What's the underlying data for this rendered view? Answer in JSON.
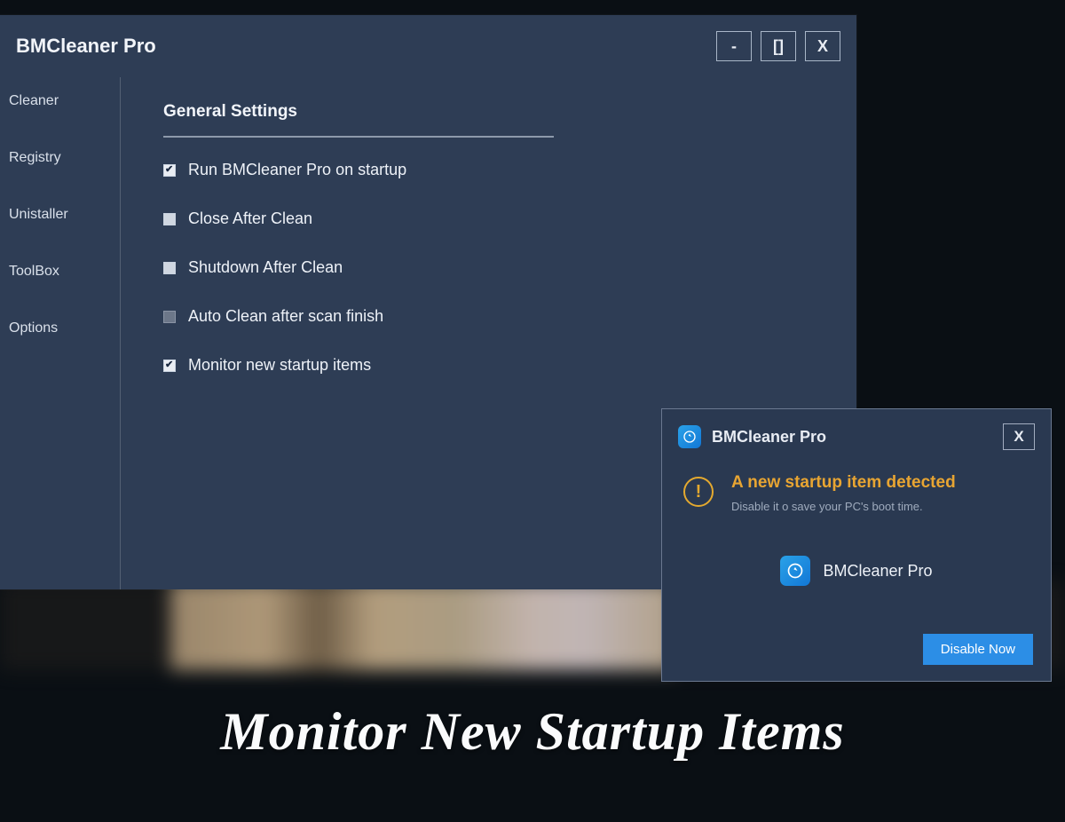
{
  "window": {
    "title": "BMCleaner Pro",
    "controls": {
      "min": "-",
      "max": "[]",
      "close": "X"
    }
  },
  "sidebar": {
    "items": [
      {
        "label": "Cleaner"
      },
      {
        "label": "Registry"
      },
      {
        "label": "Unistaller"
      },
      {
        "label": "ToolBox"
      },
      {
        "label": "Options"
      }
    ]
  },
  "settings": {
    "heading": "General Settings",
    "options": [
      {
        "label": "Run BMCleaner Pro on startup",
        "state": "checked"
      },
      {
        "label": "Close After Clean",
        "state": "empty"
      },
      {
        "label": "Shutdown After Clean",
        "state": "empty"
      },
      {
        "label": "Auto Clean after scan finish",
        "state": "dim"
      },
      {
        "label": "Monitor new startup items",
        "state": "checked"
      }
    ]
  },
  "popup": {
    "title": "BMCleaner Pro",
    "close": "X",
    "alert_heading": "A new startup item detected",
    "alert_sub": "Disable it o save your PC's boot time.",
    "detected_name": "BMCleaner Pro",
    "action": "Disable Now"
  },
  "caption": "Monitor New Startup Items"
}
